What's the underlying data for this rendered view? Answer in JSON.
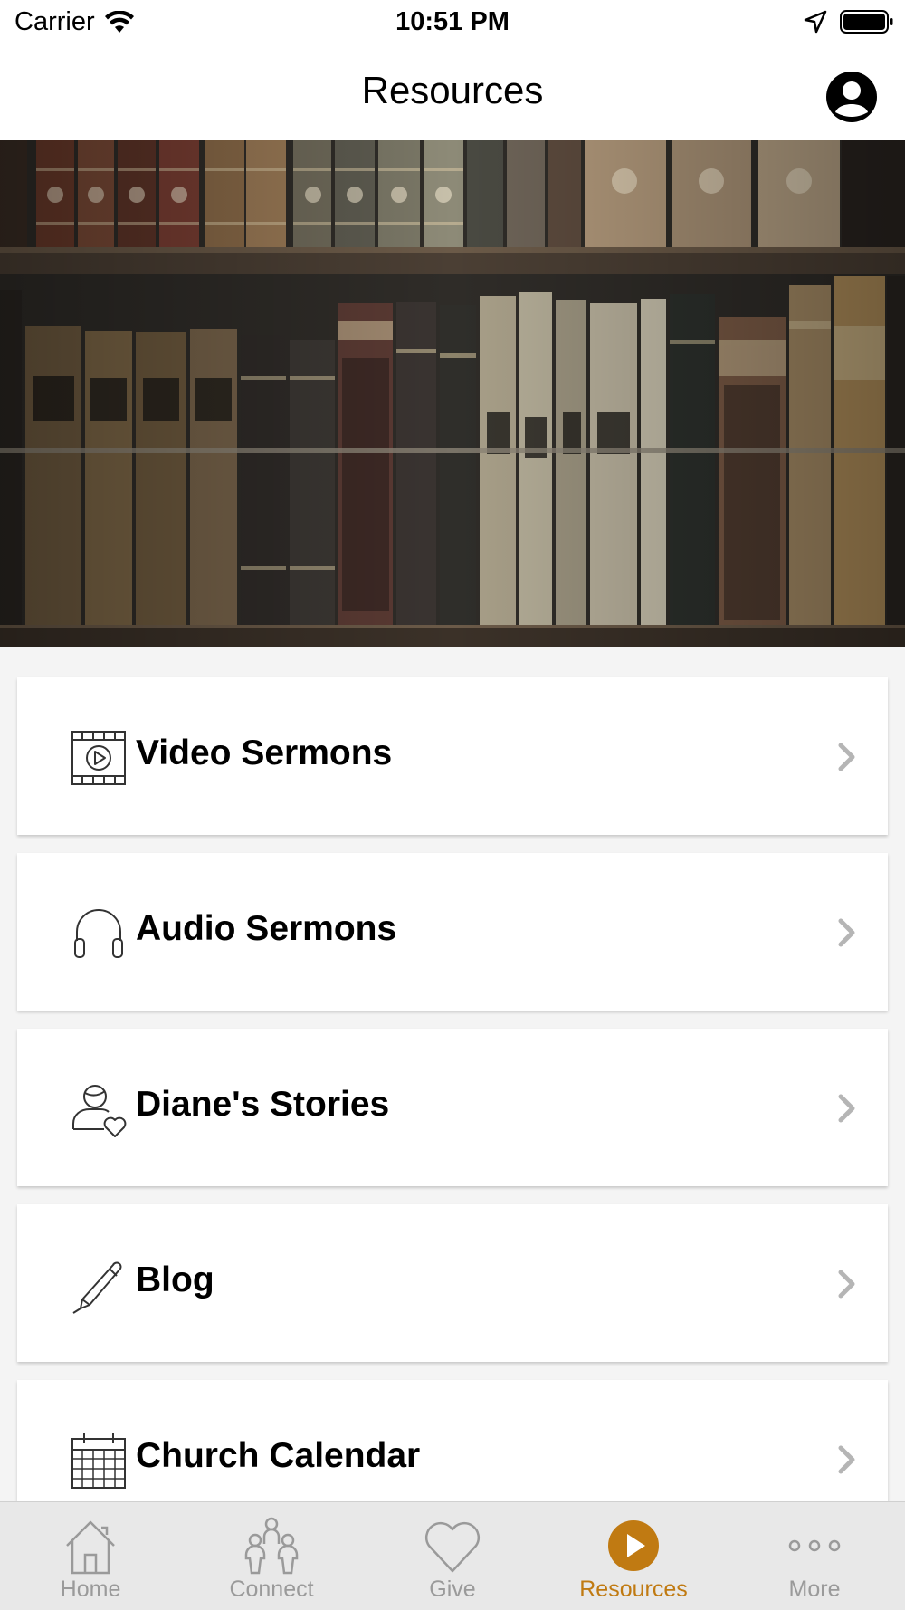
{
  "status_bar": {
    "carrier": "Carrier",
    "time": "10:51 PM"
  },
  "nav": {
    "title": "Resources"
  },
  "menu": [
    {
      "label": "Video Sermons",
      "icon": "video-icon"
    },
    {
      "label": "Audio Sermons",
      "icon": "headphones-icon"
    },
    {
      "label": "Diane's Stories",
      "icon": "person-heart-icon"
    },
    {
      "label": "Blog",
      "icon": "pen-icon"
    },
    {
      "label": "Church Calendar",
      "icon": "calendar-icon"
    }
  ],
  "tabs": [
    {
      "label": "Home",
      "icon": "home-icon"
    },
    {
      "label": "Connect",
      "icon": "people-icon"
    },
    {
      "label": "Give",
      "icon": "heart-icon"
    },
    {
      "label": "Resources",
      "icon": "play-icon",
      "active": true
    },
    {
      "label": "More",
      "icon": "more-icon"
    }
  ],
  "colors": {
    "accent": "#c07a12",
    "inactive": "#9a9a9a",
    "tab_bar_bg": "#e8e8e8"
  }
}
